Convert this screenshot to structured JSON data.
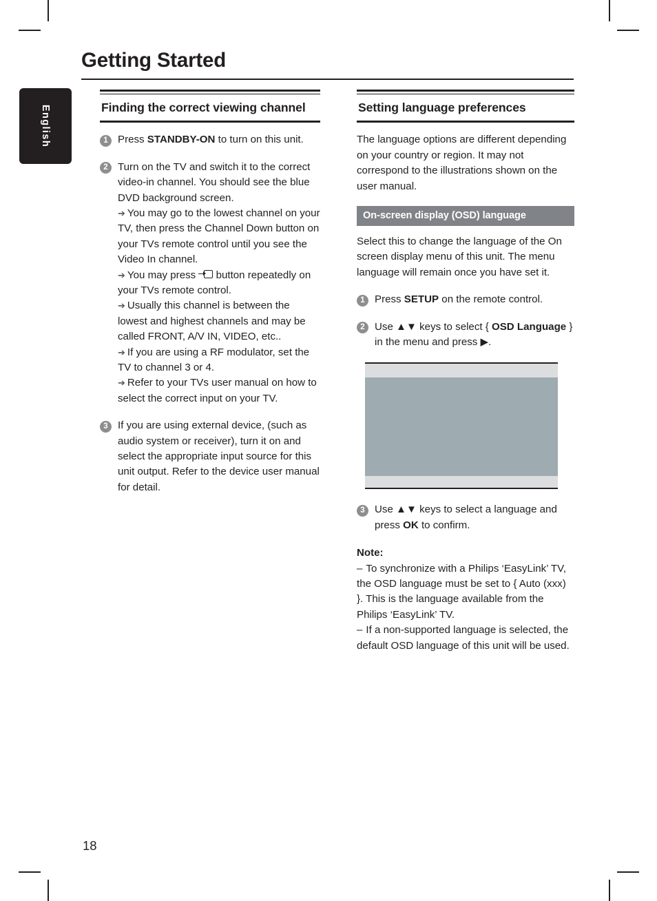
{
  "page": {
    "title": "Getting Started",
    "number": "18",
    "language_tab": "English"
  },
  "left_column": {
    "section_title": "Finding the correct viewing channel",
    "steps": [
      {
        "num": "1",
        "text_before": "Press ",
        "bold": "STANDBY-ON",
        "text_after": " to turn on this unit."
      },
      {
        "num": "2",
        "text": "Turn on the TV and switch it to the correct video-in channel. You should see the blue DVD background screen.",
        "subs": [
          "You may go to the lowest channel on your TV, then press the Channel Down button on your TVs remote control until you see the Video In channel.",
          "You may press   button repeatedly on your TVs remote control.",
          "Usually this channel is between the lowest and highest channels and may be called FRONT, A/V IN, VIDEO, etc..",
          "If you are using a RF modulator, set the TV to channel 3 or 4.",
          "Refer to your TVs user manual on how to select the correct input on your TV."
        ],
        "sub2_prefix": "You may press ",
        "sub2_suffix": " button repeatedly on your TVs remote control."
      },
      {
        "num": "3",
        "text": "If you are using external device, (such as audio system or receiver), turn it on and select the appropriate input source for this unit output. Refer to the device user manual for detail."
      }
    ]
  },
  "right_column": {
    "section_title": "Setting language preferences",
    "intro": "The language options are different depending on your country or region. It may not correspond to the illustrations shown on the user manual.",
    "banner": "On-screen display (OSD) language",
    "banner_body": "Select this to change the language of the On screen display menu of this unit. The menu language will remain once you have set it.",
    "steps": [
      {
        "num": "1",
        "text_before": "Press ",
        "bold": "SETUP",
        "text_after": " on the remote control."
      },
      {
        "num": "2",
        "part1": "Use ",
        "keys": "▲▼",
        "part2": " keys to select { ",
        "bold": "OSD Language",
        "part3": " } in the menu and press ",
        "arrow": "▶",
        "part4": "."
      },
      {
        "num": "3",
        "part1": "Use ",
        "keys": "▲▼",
        "part2": " keys to select a language and press ",
        "bold": "OK",
        "part3": " to confirm."
      }
    ],
    "note_title": "Note:",
    "notes": [
      "To synchronize with a Philips ‘EasyLink’ TV, the OSD language must be set to { Auto (xxx) }. This is the language available from the Philips ‘EasyLink’ TV.",
      "If a non-supported language is selected, the default OSD language of this unit will be used."
    ]
  },
  "colors": {
    "ink": "#231f20",
    "step_bullet": "#8e8e8e",
    "banner_bg": "#808387",
    "figure_screen": "#9eabb0",
    "figure_band": "#dcdddf"
  },
  "icons": {
    "tv_input": "tv-input-source-icon",
    "arrow_bullet": "➔",
    "dash_bullet": "–"
  }
}
